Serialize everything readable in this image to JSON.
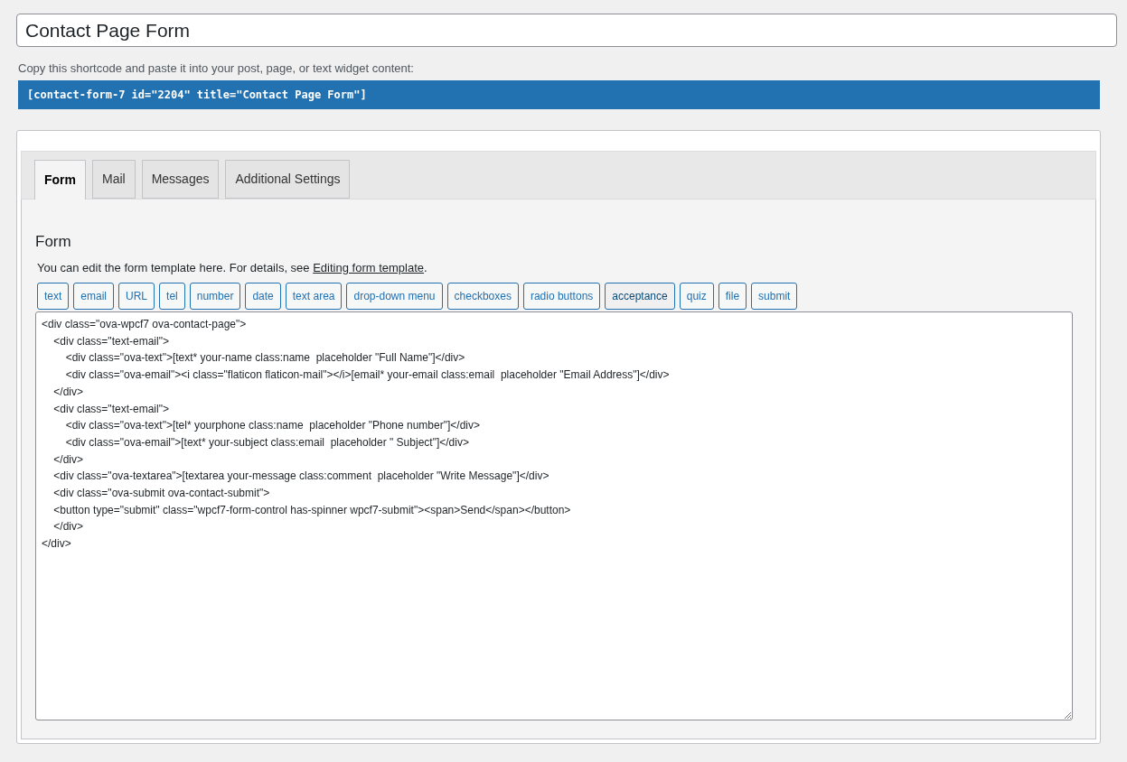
{
  "title_field": {
    "value": "Contact Page Form"
  },
  "shortcode": {
    "hint": "Copy this shortcode and paste it into your post, page, or text widget content:",
    "code": "[contact-form-7 id=\"2204\" title=\"Contact Page Form\"]"
  },
  "tabs": [
    {
      "label": "Form",
      "selected": true
    },
    {
      "label": "Mail",
      "selected": false
    },
    {
      "label": "Messages",
      "selected": false
    },
    {
      "label": "Additional Settings",
      "selected": false
    }
  ],
  "panel": {
    "heading": "Form",
    "description_before": "You can edit the form template here. For details, see ",
    "link": "Editing form template",
    "description_after": "."
  },
  "tag_buttons": [
    {
      "label": "text",
      "selected": false
    },
    {
      "label": "email",
      "selected": false
    },
    {
      "label": "URL",
      "selected": false
    },
    {
      "label": "tel",
      "selected": false
    },
    {
      "label": "number",
      "selected": false
    },
    {
      "label": "date",
      "selected": false
    },
    {
      "label": "text area",
      "selected": false
    },
    {
      "label": "drop-down menu",
      "selected": false
    },
    {
      "label": "checkboxes",
      "selected": false
    },
    {
      "label": "radio buttons",
      "selected": false
    },
    {
      "label": "acceptance",
      "selected": true
    },
    {
      "label": "quiz",
      "selected": false
    },
    {
      "label": "file",
      "selected": false
    },
    {
      "label": "submit",
      "selected": false
    }
  ],
  "template_lines": [
    "<div class=\"ova-wpcf7 ova-contact-page\">",
    "    <div class=\"text-email\">",
    "        <div class=\"ova-text\">[text* your-name class:name  placeholder \"Full Name\"]</div>",
    "        <div class=\"ova-email\"><i class=\"flaticon flaticon-mail\"></i>[email* your-email class:email  placeholder \"Email Address\"]</div>",
    "    </div>",
    "    <div class=\"text-email\">",
    "        <div class=\"ova-text\">[tel* yourphone class:name  placeholder \"Phone number\"]</div>",
    "        <div class=\"ova-email\">[text* your-subject class:email  placeholder \" Subject\"]</div>",
    "    </div>",
    "    <div class=\"ova-textarea\">[textarea your-message class:comment  placeholder \"Write Message\"]</div>",
    "    <div class=\"ova-submit ova-contact-submit\">",
    "    <button type=\"submit\" class=\"wpcf7-form-control has-spinner wpcf7-submit\"><span>Send</span></button>",
    "    </div>",
    "</div>"
  ]
}
